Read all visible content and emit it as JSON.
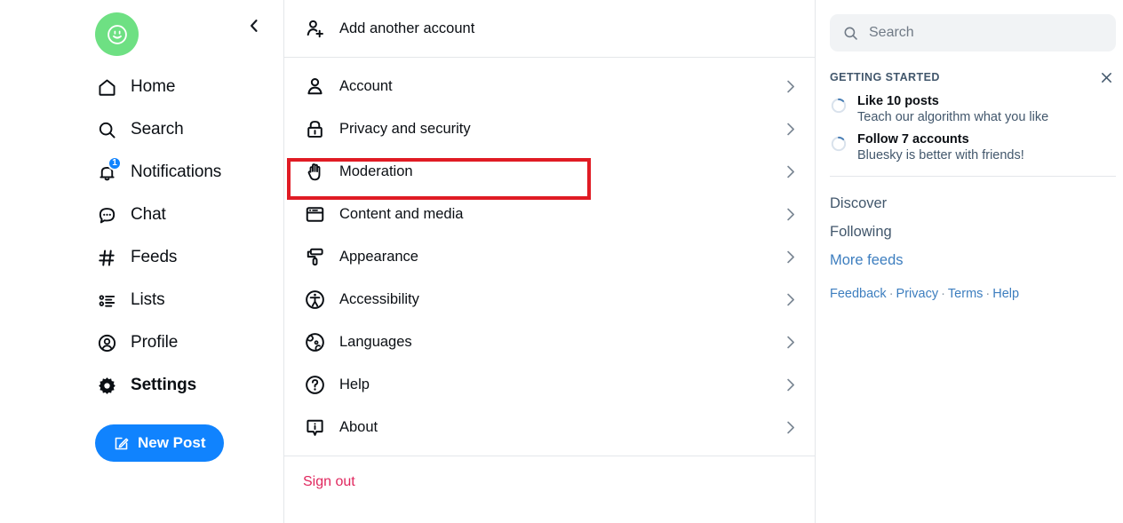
{
  "left_nav": {
    "avatar_icon": "smiley-avatar",
    "collapse_icon": "chevron-left-icon",
    "items": [
      {
        "label": "Home",
        "icon": "home-icon",
        "active": false,
        "badge": null
      },
      {
        "label": "Search",
        "icon": "search-icon",
        "active": false,
        "badge": null
      },
      {
        "label": "Notifications",
        "icon": "bell-icon",
        "active": false,
        "badge": "1"
      },
      {
        "label": "Chat",
        "icon": "chat-bubble-icon",
        "active": false,
        "badge": null
      },
      {
        "label": "Feeds",
        "icon": "hash-icon",
        "active": false,
        "badge": null
      },
      {
        "label": "Lists",
        "icon": "list-icon",
        "active": false,
        "badge": null
      },
      {
        "label": "Profile",
        "icon": "person-circle-icon",
        "active": false,
        "badge": null
      },
      {
        "label": "Settings",
        "icon": "gear-icon",
        "active": true,
        "badge": null
      }
    ],
    "new_post_label": "New Post",
    "new_post_icon": "compose-icon"
  },
  "settings": {
    "add_account": {
      "label": "Add another account",
      "icon": "person-plus-icon"
    },
    "items": [
      {
        "label": "Account",
        "icon": "person-icon"
      },
      {
        "label": "Privacy and security",
        "icon": "lock-icon"
      },
      {
        "label": "Moderation",
        "icon": "hand-icon",
        "highlighted": true
      },
      {
        "label": "Content and media",
        "icon": "window-icon"
      },
      {
        "label": "Appearance",
        "icon": "paint-roller-icon"
      },
      {
        "label": "Accessibility",
        "icon": "accessibility-icon"
      },
      {
        "label": "Languages",
        "icon": "globe-icon"
      },
      {
        "label": "Help",
        "icon": "question-circle-icon"
      },
      {
        "label": "About",
        "icon": "info-bubble-icon"
      }
    ],
    "sign_out_label": "Sign out",
    "sign_out_color": "#e0275e",
    "highlight_color": "#e01b24"
  },
  "right_sidebar": {
    "search_placeholder": "Search",
    "search_icon": "search-icon",
    "getting_started": {
      "title": "GETTING STARTED",
      "close_icon": "close-icon",
      "tasks": [
        {
          "title": "Like 10 posts",
          "subtitle": "Teach our algorithm what you like",
          "progress_icon": "progress-ring-icon"
        },
        {
          "title": "Follow 7 accounts",
          "subtitle": "Bluesky is better with friends!",
          "progress_icon": "progress-ring-icon"
        }
      ]
    },
    "feeds": [
      {
        "label": "Discover",
        "style": "normal"
      },
      {
        "label": "Following",
        "style": "normal"
      },
      {
        "label": "More feeds",
        "style": "link"
      }
    ],
    "footer": {
      "links": [
        "Feedback",
        "Privacy",
        "Terms",
        "Help"
      ],
      "separator": "·"
    }
  },
  "colors": {
    "accent": "#1083fe",
    "link": "#3d7ebf",
    "avatar_green": "#6ee083",
    "danger": "#e0275e",
    "highlight": "#e01b24"
  }
}
